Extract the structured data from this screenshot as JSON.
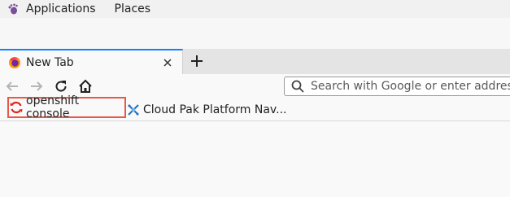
{
  "topbar": {
    "menus": [
      "Applications",
      "Places"
    ],
    "icon": "gnome-foot-icon"
  },
  "browser": {
    "tabs": [
      {
        "title": "New Tab",
        "favicon": "firefox-icon",
        "close_icon": "close-icon"
      }
    ],
    "new_tab_icon": "plus-icon",
    "nav": {
      "back_icon": "back-arrow-icon",
      "forward_icon": "forward-arrow-icon",
      "reload_icon": "reload-icon",
      "home_icon": "home-icon"
    },
    "urlbar": {
      "placeholder": "Search with Google or enter address",
      "value": "",
      "icon": "search-icon"
    },
    "bookmarks": [
      {
        "label": "openshift console",
        "icon": "openshift-refresh-icon",
        "highlighted": true,
        "highlight_color": "#e8584a"
      },
      {
        "label": "Cloud Pak Platform Nav...",
        "icon": "cloud-pak-icon"
      }
    ]
  },
  "colors": {
    "accent_tab": "#0a84ff",
    "highlight_border": "#e8584a"
  }
}
